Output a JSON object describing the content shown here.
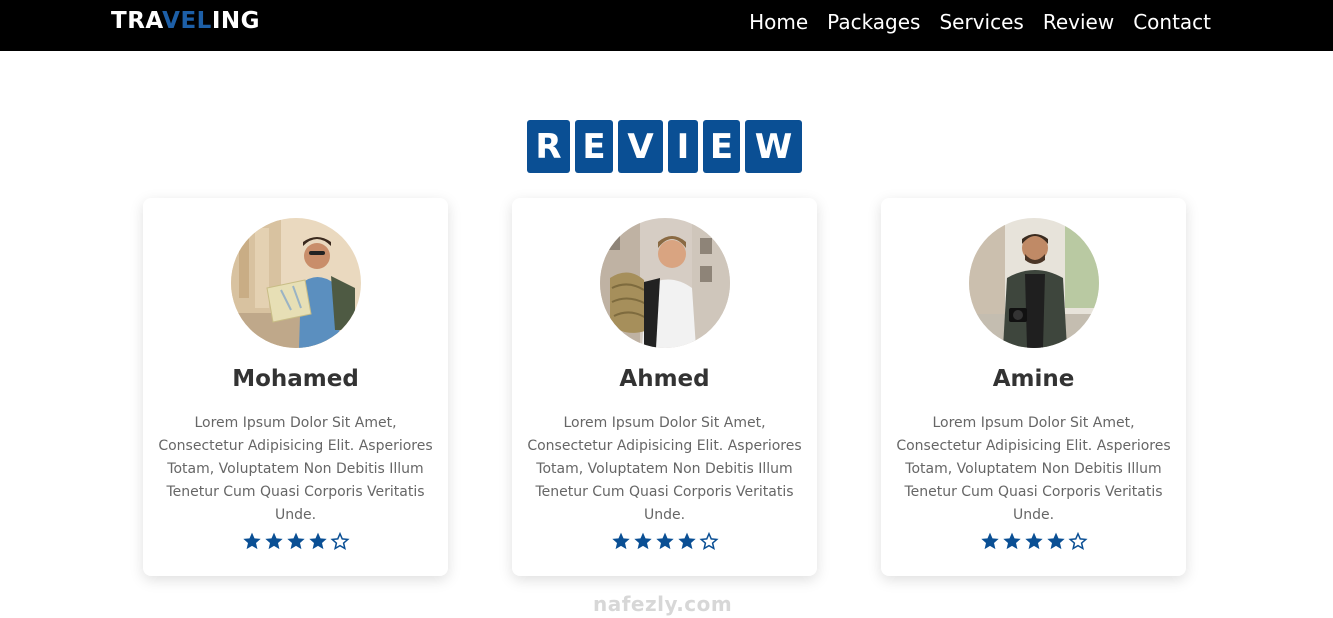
{
  "nav": {
    "logo_parts": [
      "TRA",
      "VEL",
      "ING"
    ],
    "links": [
      "Home",
      "Packages",
      "Services",
      "Review",
      "Contact"
    ]
  },
  "section": {
    "title_letters": [
      "R",
      "E",
      "V",
      "I",
      "E",
      "W"
    ]
  },
  "reviews": [
    {
      "name": "Mohamed",
      "text": "Lorem Ipsum Dolor Sit Amet, Consectetur Adipisicing Elit. Asperiores Totam, Voluptatem Non Debitis Illum Tenetur Cum Quasi Corporis Veritatis Unde.",
      "rating": 4,
      "max_rating": 5
    },
    {
      "name": "Ahmed",
      "text": "Lorem Ipsum Dolor Sit Amet, Consectetur Adipisicing Elit. Asperiores Totam, Voluptatem Non Debitis Illum Tenetur Cum Quasi Corporis Veritatis Unde.",
      "rating": 4,
      "max_rating": 5
    },
    {
      "name": "Amine",
      "text": "Lorem Ipsum Dolor Sit Amet, Consectetur Adipisicing Elit. Asperiores Totam, Voluptatem Non Debitis Illum Tenetur Cum Quasi Corporis Veritatis Unde.",
      "rating": 4,
      "max_rating": 5
    }
  ],
  "watermark": "nafezly.com",
  "colors": {
    "accent": "#0a4f94",
    "logo_accent": "#1d5fa7",
    "navbar": "#000000",
    "star": "#0a4f94"
  },
  "icons": {
    "filled_star": "star-filled-icon",
    "empty_star": "star-empty-icon"
  }
}
